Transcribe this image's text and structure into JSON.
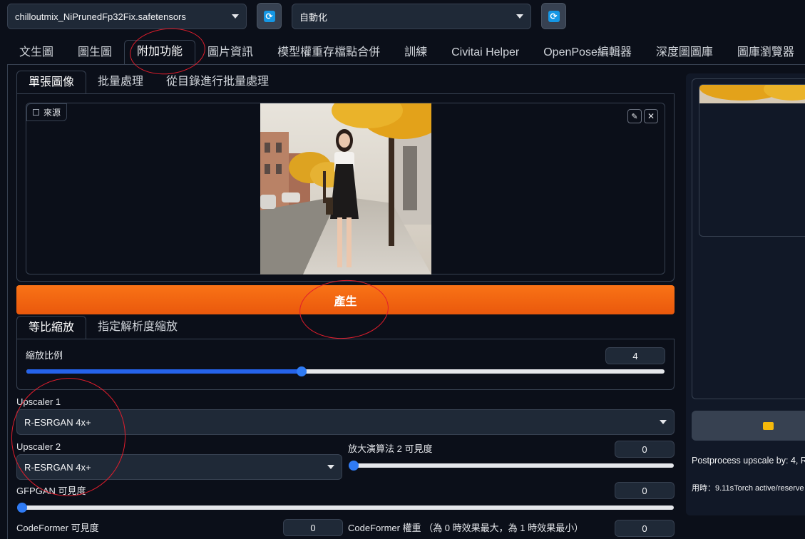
{
  "header": {
    "model_select": "chilloutmix_NiPrunedFp32Fix.safetensors",
    "vae_select": "自動化"
  },
  "tabs": [
    {
      "label": "文生圖"
    },
    {
      "label": "圖生圖"
    },
    {
      "label": "附加功能"
    },
    {
      "label": "圖片資訊"
    },
    {
      "label": "模型權重存檔點合併"
    },
    {
      "label": "訓練"
    },
    {
      "label": "Civitai Helper"
    },
    {
      "label": "OpenPose編輯器"
    },
    {
      "label": "深度圖圖庫"
    },
    {
      "label": "圖庫瀏覽器"
    }
  ],
  "subtabs": [
    {
      "label": "單張圖像"
    },
    {
      "label": "批量處理"
    },
    {
      "label": "從目錄進行批量處理"
    }
  ],
  "source": {
    "label": "來源"
  },
  "generate_label": "產生",
  "resize_tabs": [
    {
      "label": "等比縮放"
    },
    {
      "label": "指定解析度縮放"
    }
  ],
  "scale": {
    "label": "縮放比例",
    "value": "4",
    "fraction": 0.4316
  },
  "upscaler1": {
    "label": "Upscaler 1",
    "value": "R-ESRGAN 4x+"
  },
  "upscaler2": {
    "label": "Upscaler 2",
    "value": "R-ESRGAN 4x+"
  },
  "upscaler2_visibility": {
    "label": "放大演算法 2 可見度",
    "value": "0",
    "fraction": 0
  },
  "gfpgan": {
    "label": "GFPGAN 可見度",
    "value": "0",
    "fraction": 0
  },
  "codeformer": {
    "label": "CodeFormer 可見度",
    "value": "0"
  },
  "codeformer_weight": {
    "label": "CodeFormer 權重 （為 0 時效果最大，為 1 時效果最小）",
    "value": "0"
  },
  "output": {
    "info": "Postprocess upscale by: 4, R",
    "time": "用時：9.11sTorch active/reserve"
  },
  "colors": {
    "accent": "#f97316",
    "slider": "#2563eb",
    "annotation": "#e11d2c"
  }
}
